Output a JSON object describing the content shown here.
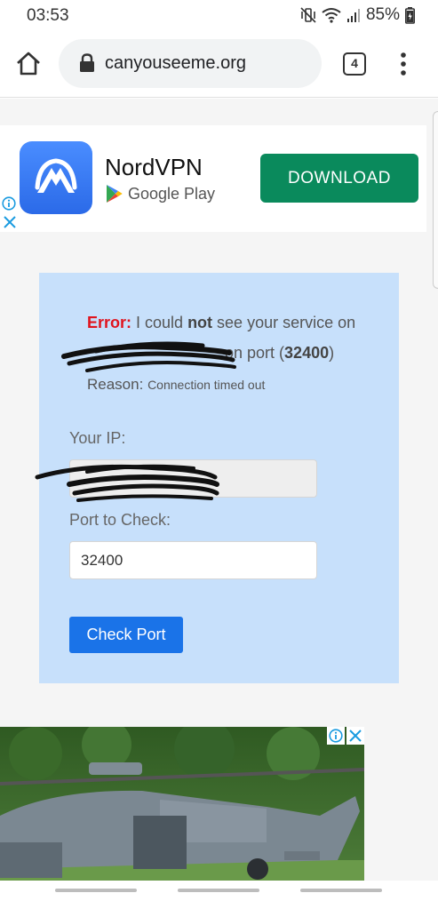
{
  "status_bar": {
    "time": "03:53",
    "battery": "85%",
    "icons": [
      "mute-vibrate-icon",
      "wifi-icon",
      "signal-icon",
      "battery-charging-icon"
    ]
  },
  "browser": {
    "url": "canyouseeme.org",
    "tab_count": "4",
    "icons": [
      "home-icon",
      "lock-icon",
      "overflow-menu-icon"
    ]
  },
  "ad_banner": {
    "app_name": "NordVPN",
    "store": "Google Play",
    "cta": "DOWNLOAD",
    "colors": {
      "cta": "#0a8a5c",
      "icon": "#2b6ae8"
    }
  },
  "result": {
    "error_label": "Error:",
    "error_text_1": " I could ",
    "error_strong": "not",
    "error_text_2": " see your service on",
    "port_text_1": " on port (",
    "port_value": "32400",
    "port_text_2": ")",
    "reason_label": "Reason:",
    "reason_detail": "Connection timed out",
    "colors": {
      "error": "#e0141e",
      "panel": "#c7e0fb"
    }
  },
  "form": {
    "ip_label": "Your IP:",
    "port_label": "Port to Check:",
    "port_value": "32400",
    "button_label": "Check Port",
    "colors": {
      "button": "#1a73e8"
    }
  },
  "bottom_ad": {
    "icons": [
      "ad-info-icon",
      "ad-close-icon"
    ]
  }
}
